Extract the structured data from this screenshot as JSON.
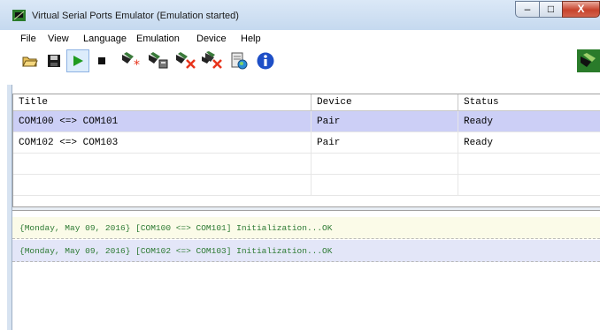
{
  "window": {
    "title": "Virtual Serial Ports Emulator (Emulation started)",
    "min_glyph": "–",
    "max_glyph": "□",
    "close_glyph": "X"
  },
  "menu": [
    "File",
    "View",
    "Language",
    "Emulation",
    "Device",
    "Help"
  ],
  "toolbar": {
    "buttons": [
      "open-icon",
      "save-icon",
      "start-emulation-icon",
      "stop-emulation-icon",
      "create-device-icon",
      "edit-device-icon",
      "delete-device-icon",
      "delete-all-devices-icon",
      "properties-icon",
      "about-info-icon",
      "emulator-logo-icon"
    ],
    "pressed": "start-emulation-icon"
  },
  "table": {
    "columns": [
      "Title",
      "Device",
      "Status"
    ],
    "rows": [
      {
        "title": "COM100 <=> COM101",
        "device": "Pair",
        "status": "Ready",
        "selected": true
      },
      {
        "title": "COM102 <=> COM103",
        "device": "Pair",
        "status": "Ready",
        "selected": false
      }
    ]
  },
  "log": [
    "{Monday, May 09, 2016} [COM100 <=> COM101] Initialization...OK",
    "{Monday, May 09, 2016} [COM102 <=> COM103] Initialization...OK"
  ],
  "colors": {
    "selection": "#cccff6",
    "log_text": "#2d7a33",
    "play": "#1f9b1f",
    "info": "#1e4fc7",
    "close_button": "#c7432c"
  }
}
